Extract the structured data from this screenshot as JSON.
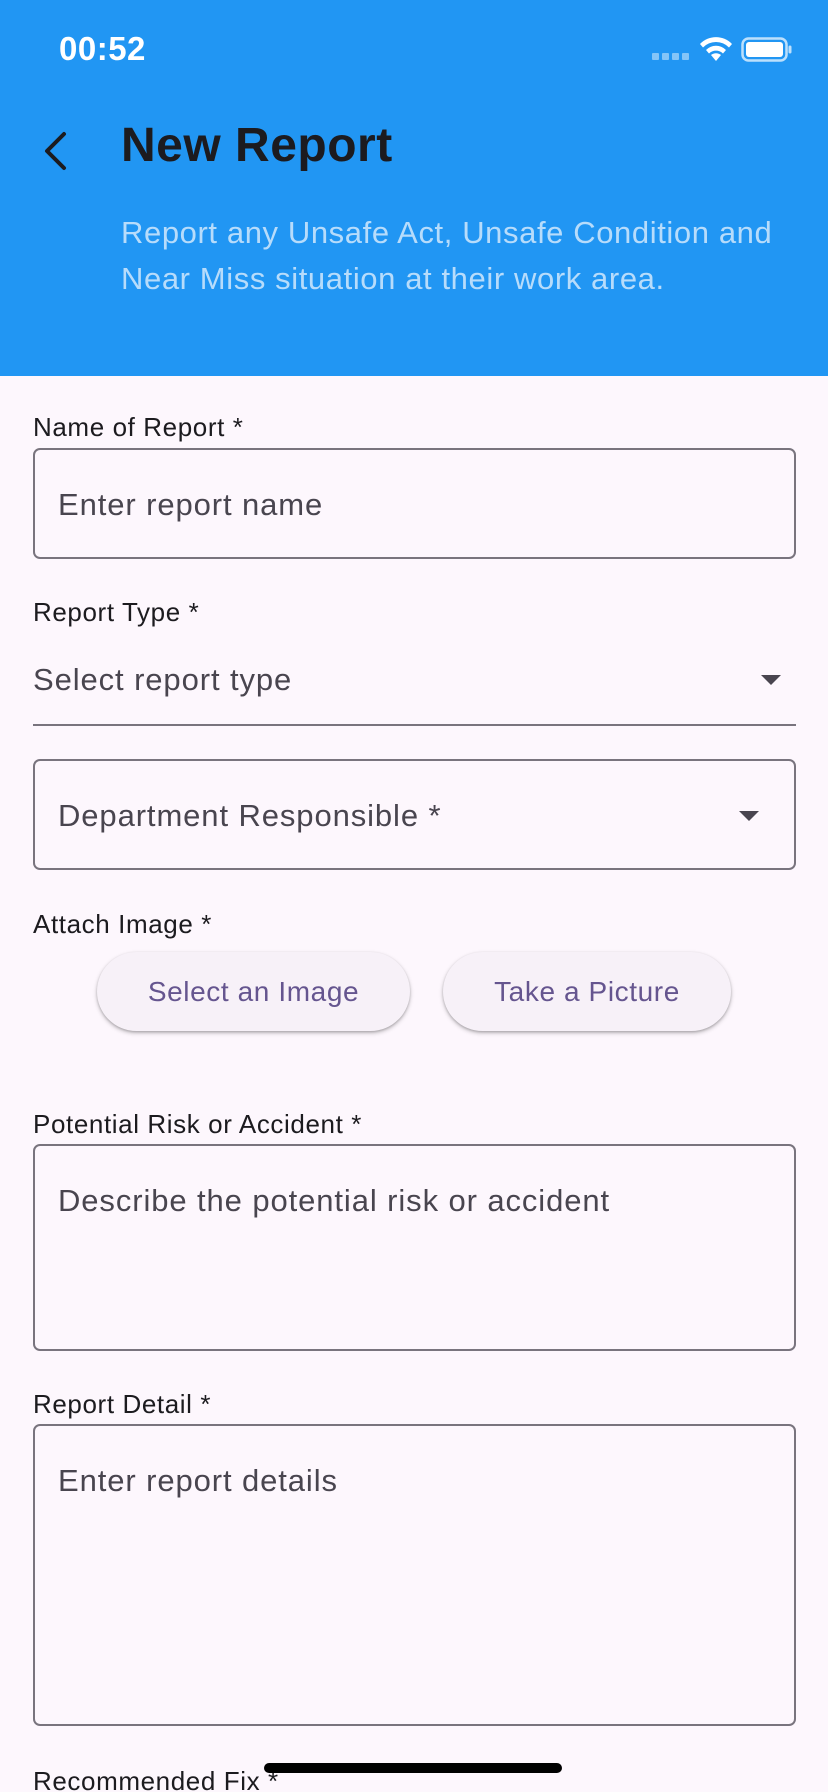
{
  "status_bar": {
    "time": "00:52"
  },
  "header": {
    "title": "New Report",
    "subtitle": "Report any Unsafe Act, Unsafe Condition and Near Miss situation at their work area."
  },
  "form": {
    "report_name": {
      "label": "Name of Report *",
      "placeholder": "Enter report name"
    },
    "report_type": {
      "label": "Report Type *",
      "placeholder": "Select report type"
    },
    "department": {
      "placeholder": "Department Responsible *"
    },
    "attach_image": {
      "label": "Attach Image *",
      "select_button": "Select an Image",
      "camera_button": "Take a Picture"
    },
    "potential_risk": {
      "label": "Potential Risk or Accident *",
      "placeholder": "Describe the potential risk or accident"
    },
    "report_detail": {
      "label": "Report Detail *",
      "placeholder": "Enter report details"
    },
    "recommended_fix": {
      "label": "Recommended Fix *"
    }
  },
  "colors": {
    "header_bg": "#2196f3",
    "page_bg": "#fdf7fd",
    "button_text": "#65558f",
    "border": "#79747e"
  }
}
